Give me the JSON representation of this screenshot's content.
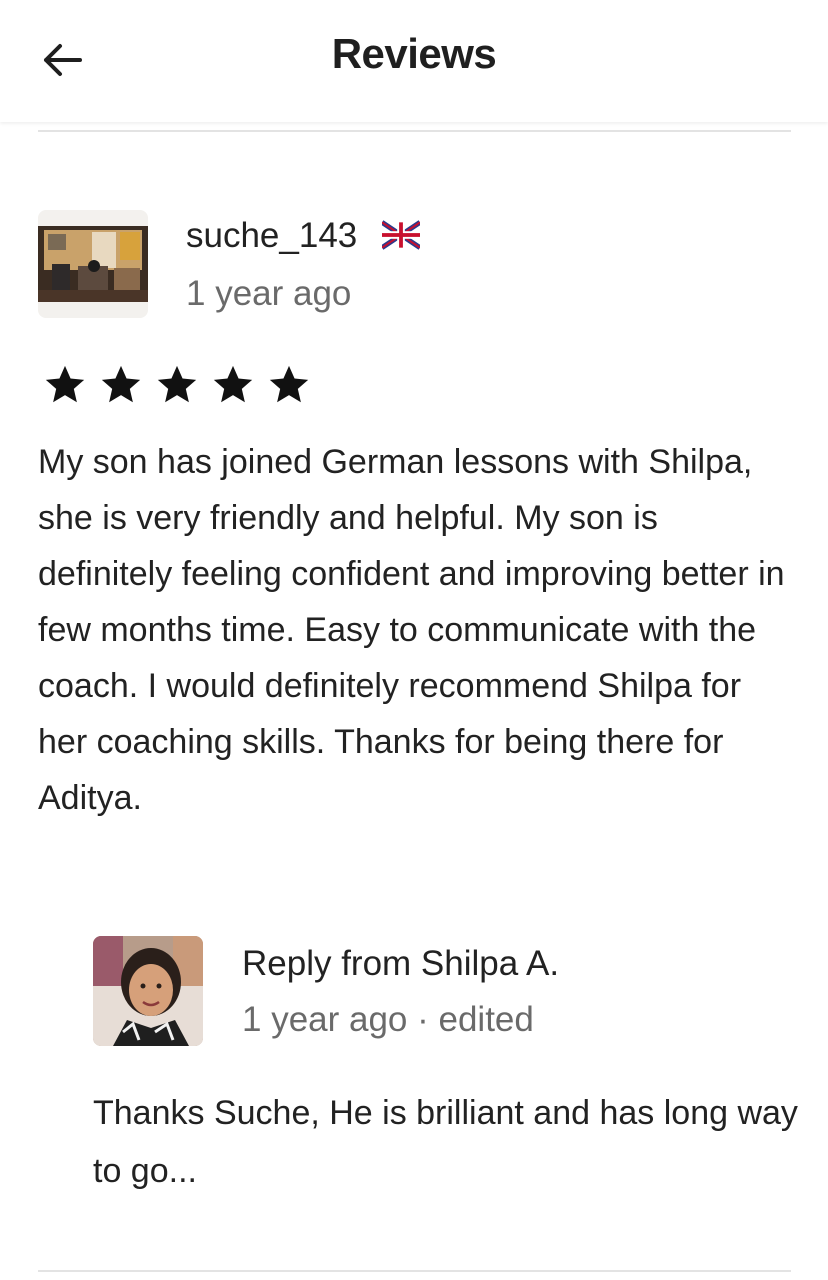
{
  "header": {
    "title": "Reviews",
    "back_icon": "arrow-left-icon"
  },
  "review": {
    "author": "suche_143",
    "flag_icon": "uk-flag-icon",
    "time": "1 year ago",
    "rating": 5,
    "rating_max": 5,
    "text": "My son has joined German lessons with Shilpa, she is very friendly and helpful. My son is definitely feeling confident and improving better in few months time. Easy to communicate with the coach. I would definitely recommend Shilpa for her coaching skills. Thanks for being there for Aditya."
  },
  "reply": {
    "title": "Reply from Shilpa A.",
    "time": "1 year ago · edited",
    "text": "Thanks Suche, He is brilliant and has long way to go..."
  }
}
